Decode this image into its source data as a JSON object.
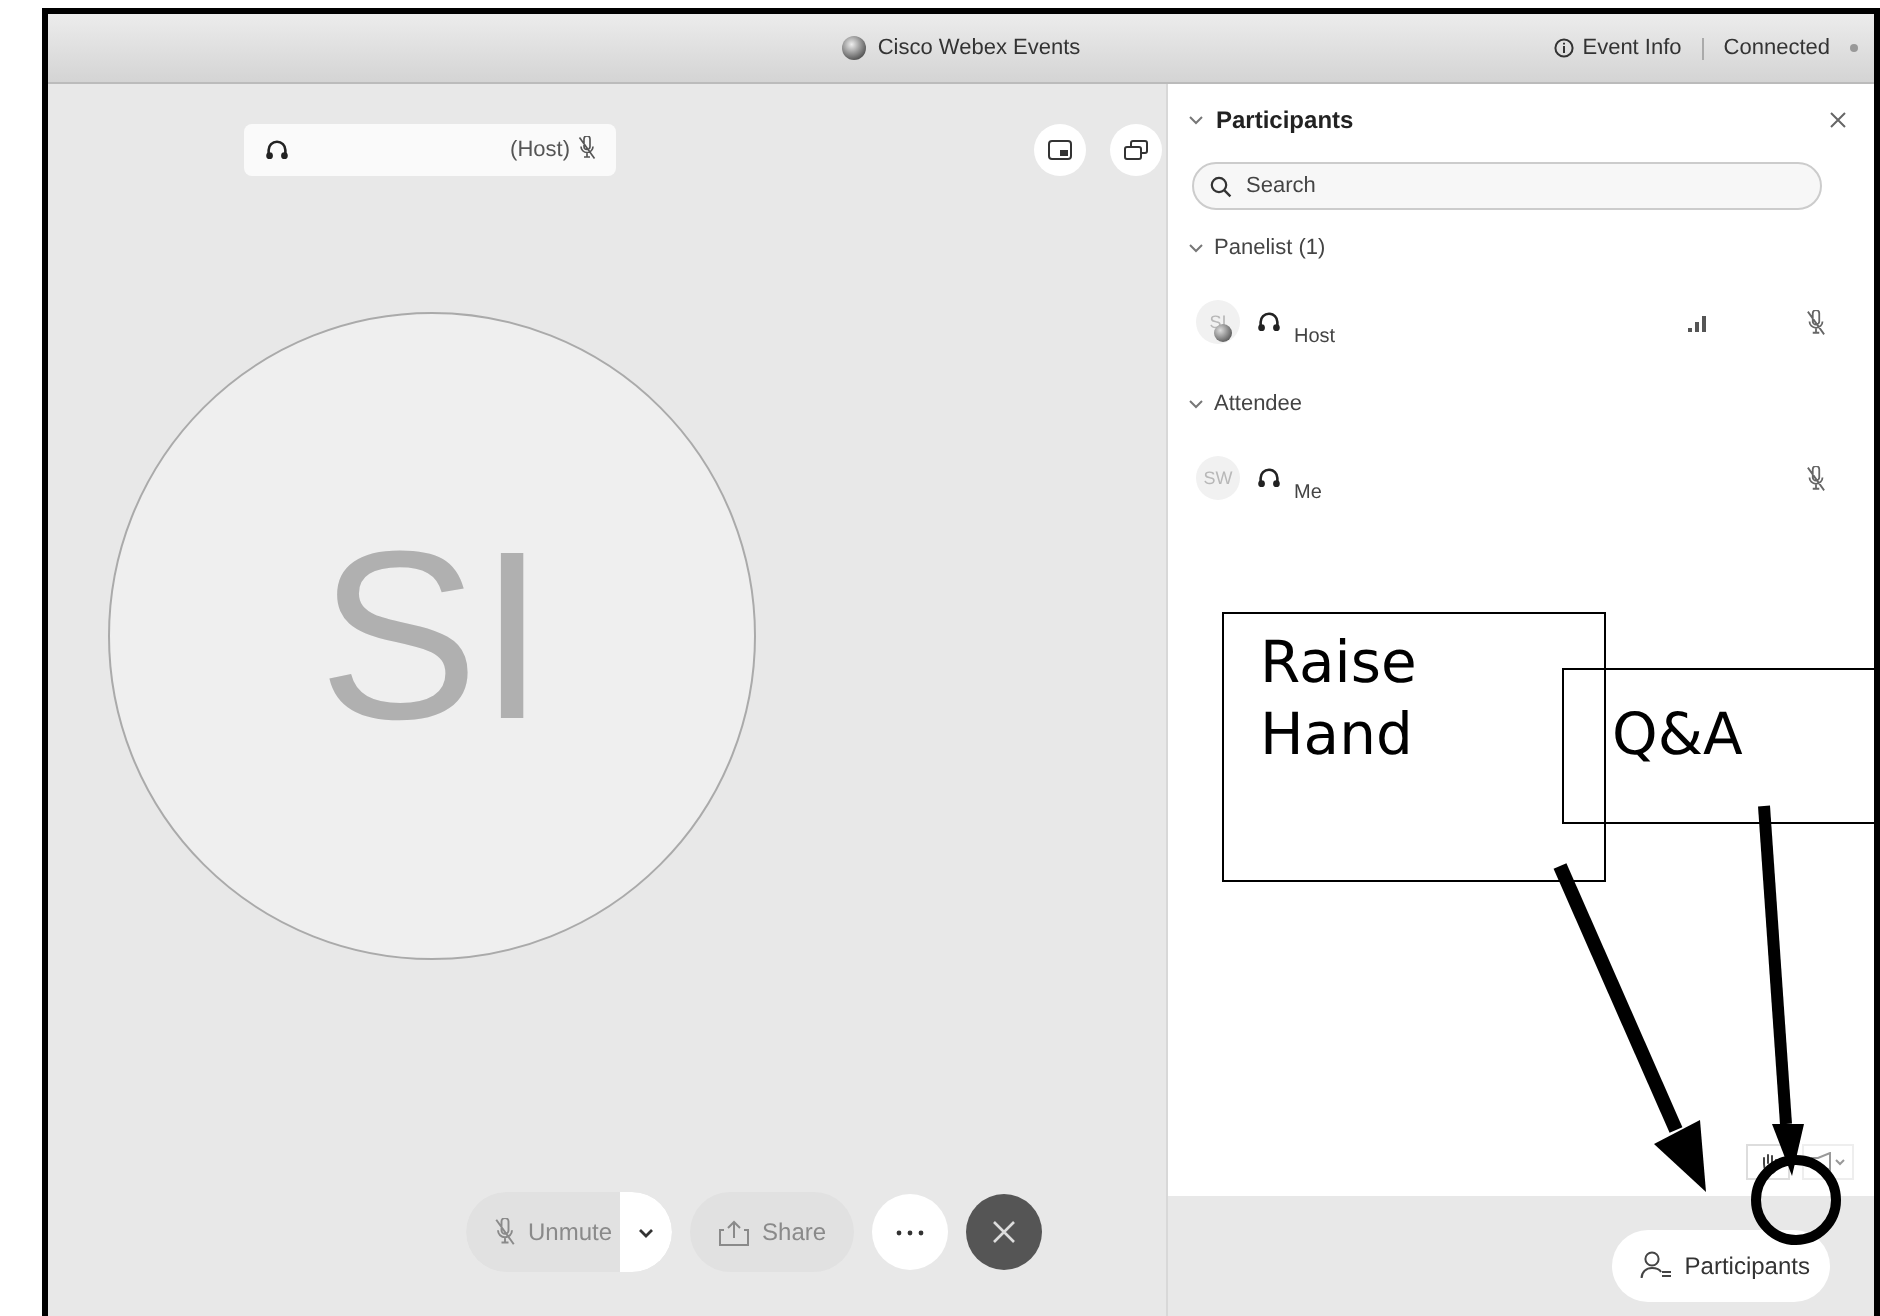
{
  "window": {
    "title": "Cisco Webex Events",
    "event_info": "Event Info",
    "status": "Connected"
  },
  "stage": {
    "name_tag": "(Host)",
    "name_muted": true,
    "avatar_initials": "SI"
  },
  "participants_panel": {
    "title": "Participants",
    "expanded": true,
    "search": {
      "placeholder": "Search"
    },
    "groups": [
      {
        "label": "Panelist (1)",
        "expanded": true,
        "members": [
          {
            "initials": "SI",
            "role": "Host",
            "kind": "panelist",
            "muted": true
          }
        ]
      },
      {
        "label": "Attendee",
        "expanded": true,
        "members": [
          {
            "initials": "SW",
            "role": "Me",
            "kind": "attendee",
            "muted": true
          }
        ]
      }
    ]
  },
  "controls": {
    "unmute": {
      "label": "Unmute",
      "disabled": true
    },
    "share": {
      "label": "Share",
      "disabled": true
    }
  },
  "participants_button": "Participants",
  "annotations": [
    {
      "kind": "raise-hand",
      "text": "Raise Hand"
    },
    {
      "kind": "qa",
      "text": "Q&A"
    }
  ]
}
